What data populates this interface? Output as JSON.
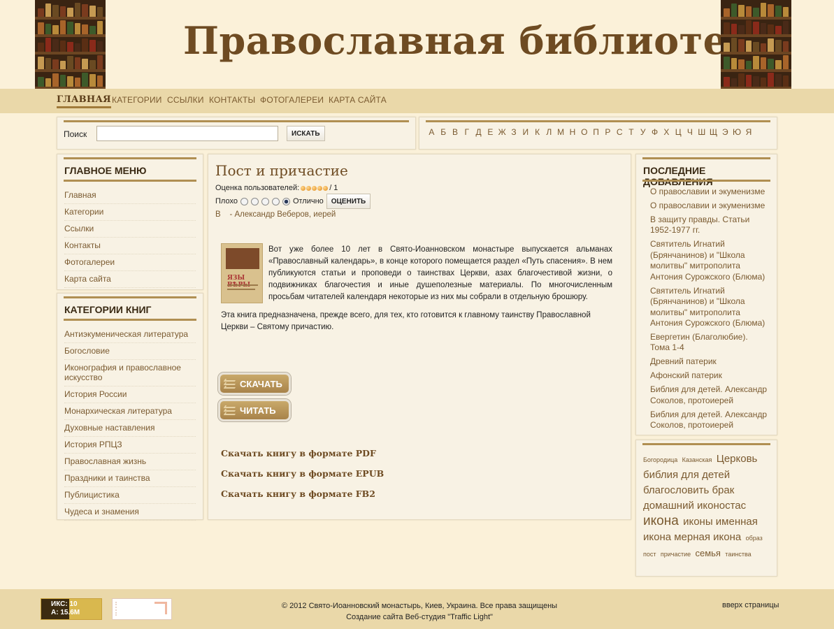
{
  "header": {
    "site_title": "Православная библиотека"
  },
  "nav": {
    "items": [
      {
        "label": "Главная",
        "active": true
      },
      {
        "label": "Категории"
      },
      {
        "label": "Ссылки"
      },
      {
        "label": "Контакты"
      },
      {
        "label": "Фотогалереи"
      },
      {
        "label": "Карта сайта"
      }
    ]
  },
  "search": {
    "label": "Поиск",
    "value": "",
    "button": "ИСКАТЬ"
  },
  "alphabet": [
    "А",
    "Б",
    "В",
    "Г",
    "Д",
    "Е",
    "Ж",
    "З",
    "И",
    "К",
    "Л",
    "М",
    "Н",
    "О",
    "П",
    "Р",
    "С",
    "Т",
    "У",
    "Ф",
    "Х",
    "Ц",
    "Ч",
    "Ш",
    "Щ",
    "Э",
    "Ю",
    "Я"
  ],
  "main_menu": {
    "title": "ГЛАВНОЕ МЕНЮ",
    "items": [
      "Главная",
      "Категории",
      "Ссылки",
      "Контакты",
      "Фотогалереи",
      "Карта сайта"
    ]
  },
  "book_categories": {
    "title": "КАТЕГОРИИ КНИГ",
    "items": [
      "Антиэкуменическая литература",
      "Богословие",
      "Иконография и православное искусство",
      "История России",
      "Монархическая литература",
      "Духовные наставления",
      "История РПЦЗ",
      "Православная жизнь",
      "Праздники и таинства",
      "Публицистика",
      "Чудеса и знамения"
    ]
  },
  "article": {
    "title": "Пост и причастие",
    "rating_label": "Оценка пользователей:",
    "rating_count": "/ 1",
    "stars": 5,
    "vote_low": "Плохо",
    "vote_high": "Отлично",
    "vote_button": "ОЦЕНИТЬ",
    "selected_vote": 5,
    "author_prefix": "В",
    "author": "- Александр Веберов, иерей",
    "cover_text": "ЯЗЫ ВѢРЫ",
    "paragraph1": "Вот уже более 10 лет в Свято-Иоанновском монастыре выпускается альманах «Православный календарь», в конце которого помещается раздел «Путь спасения». В нем публикуются статьи и проповеди о таинствах Церкви, азах благочестивой жизни, о подвижниках благочестия и иные душеполезные материалы. По многочисленным просьбам читателей календаря некоторые из них мы собрали в отдельную брошюру.",
    "paragraph2": "Эта книга предназначена, прежде всего, для тех, кто готовится к главному таинству Православной Церкви – Святому причастию.",
    "download_button": "СКАЧАТЬ",
    "read_button": "ЧИТАТЬ",
    "download_links": [
      "Скачать книгу в формате PDF",
      "Скачать книгу в формате EPUB",
      "Скачать книгу в формате FB2"
    ]
  },
  "recent": {
    "title": "ПОСЛЕДНИЕ ДОБАВЛЕНИЯ",
    "items": [
      "О православии и экуменизме",
      "О православии и экуменизме",
      "В защиту правды. Статьи 1952-1977 гг.",
      "Святитель Игнатий (Брянчанинов) и \"Школа молитвы\" митрополита Антония Сурожского (Блюма)",
      "Святитель Игнатий (Брянчанинов) и \"Школа молитвы\" митрополита Антония Сурожского (Блюма)",
      "Евергетин (Благолюбие). Тома 1-4",
      "Древний патерик",
      "Афонский патерик",
      "Библия для детей. Александр Соколов, протоиерей",
      "Библия для детей. Александр Соколов, протоиерей"
    ]
  },
  "tags": [
    {
      "label": "Богородица",
      "size": 9
    },
    {
      "label": "Казанская",
      "size": 9
    },
    {
      "label": "Церковь",
      "size": 15
    },
    {
      "label": "библия для детей",
      "size": 15
    },
    {
      "label": "благословить брак",
      "size": 15
    },
    {
      "label": "домашний иконостас",
      "size": 15
    },
    {
      "label": "икона",
      "size": 19
    },
    {
      "label": "иконы именная",
      "size": 15
    },
    {
      "label": "икона мерная икона",
      "size": 15
    },
    {
      "label": "образ",
      "size": 9
    },
    {
      "label": "пост",
      "size": 9
    },
    {
      "label": "причастие",
      "size": 9
    },
    {
      "label": "семья",
      "size": 13
    },
    {
      "label": "таинства",
      "size": 9
    }
  ],
  "footer": {
    "counter_line1": "ИКС: 10",
    "counter_line2": "А: 15.6M",
    "copyright": "© 2012 Свято-Иоанновский монастырь, Киев, Украина. Все права защищены",
    "credit": "Создание сайта Веб-студия \"Traffic Light\"",
    "to_top": "вверх страницы"
  },
  "colors": {
    "accent": "#b08f52",
    "link": "#7a5a30",
    "nav_bg": "#ead8a9",
    "bg": "#fbf1d9"
  }
}
